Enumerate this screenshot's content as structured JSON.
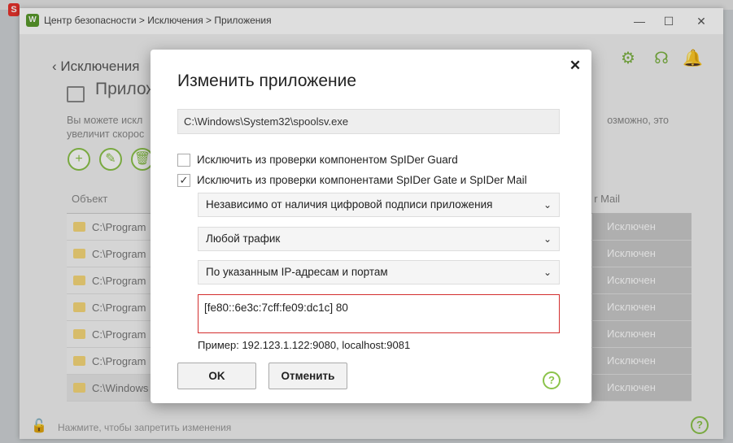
{
  "window": {
    "breadcrumb": "Центр безопасности > Исключения > Приложения",
    "minimize": "—",
    "maximize": "☐",
    "close": "✕"
  },
  "page": {
    "back_label": "Исключения",
    "title": "Прилож",
    "description_line1": "Вы можете искл",
    "description_line1_end": "озможно, это",
    "description_line2": "увеличит скорос"
  },
  "toolbar": {
    "add": "+",
    "edit": "✎",
    "delete": "🗑"
  },
  "header_icons": {
    "settings": "⚙",
    "support": "☊",
    "notifications": "🔔"
  },
  "table": {
    "col_object": "Объект",
    "col_mail": "r Mail",
    "rows": [
      {
        "path": "C:\\Program",
        "status": "Исключен"
      },
      {
        "path": "C:\\Program",
        "status": "Исключен"
      },
      {
        "path": "C:\\Program",
        "status": "Исключен"
      },
      {
        "path": "C:\\Program",
        "status": "Исключен"
      },
      {
        "path": "C:\\Program",
        "status": "Исключен"
      },
      {
        "path": "C:\\Program",
        "status": "Исключен"
      },
      {
        "path": "C:\\Windows",
        "status": "Исключен"
      }
    ]
  },
  "footer": {
    "lock_text": "Нажмите, чтобы запретить изменения",
    "help": "?"
  },
  "dialog": {
    "title": "Изменить приложение",
    "close": "✕",
    "path": "C:\\Windows\\System32\\spoolsv.exe",
    "check1": {
      "label": "Исключить из проверки компонентом SpIDer Guard",
      "checked": false
    },
    "check2": {
      "label": "Исключить из проверки компонентами SpIDer Gate и SpIDer Mail",
      "checked": true,
      "mark": "✓"
    },
    "select1": "Независимо от наличия цифровой подписи приложения",
    "select2": "Любой трафик",
    "select3": "По указанным IP-адресам и портам",
    "chevron": "⌄",
    "ip_input": "[fe80::6e3c:7cff:fe09:dc1c] 80",
    "example": "Пример: 192.123.1.122:9080, localhost:9081",
    "ok": "OK",
    "cancel": "Отменить",
    "help": "?"
  },
  "colors": {
    "accent": "#8bc34a",
    "error_border": "#d32f2f"
  }
}
